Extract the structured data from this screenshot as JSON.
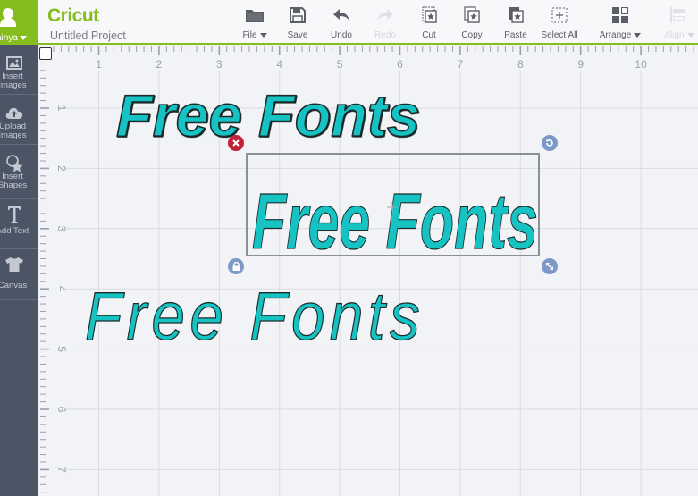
{
  "app": {
    "brand": "Cricut",
    "project_title": "Untitled Project"
  },
  "user": {
    "name": "ainya"
  },
  "toolbar": {
    "file": "File",
    "save": "Save",
    "undo": "Undo",
    "redo": "Redo",
    "cut": "Cut",
    "copy": "Copy",
    "paste": "Paste",
    "select_all": "Select All",
    "arrange": "Arrange",
    "align": "Align"
  },
  "sidebar": {
    "items": [
      {
        "label": "Insert\nImages",
        "icon": "image-icon"
      },
      {
        "label": "Upload\nImages",
        "icon": "cloud-upload-icon"
      },
      {
        "label": "Insert\nShapes",
        "icon": "shapes-icon"
      },
      {
        "label": "Add Text",
        "icon": "text-icon"
      },
      {
        "label": "Canvas",
        "icon": "tshirt-icon"
      }
    ]
  },
  "ruler": {
    "horizontal_labels": [
      "1",
      "2",
      "3",
      "4",
      "5",
      "6",
      "7",
      "8",
      "9",
      "10"
    ],
    "vertical_labels": [
      "1",
      "2",
      "3",
      "4",
      "5",
      "6",
      "7"
    ]
  },
  "canvas": {
    "text_objects": [
      {
        "text": "Free Fonts",
        "style": "brush script",
        "selected": false
      },
      {
        "text": "Free Fonts",
        "style": "handwritten",
        "selected": true
      },
      {
        "text": "Free Fonts",
        "style": "calligraphy italic",
        "selected": false
      }
    ],
    "fill_color": "#17c2c3",
    "outline_color": "#1d2b2b"
  },
  "colors": {
    "accent": "#85bd1f",
    "sidebar": "#4c5566",
    "delete_handle": "#c0223a",
    "handle": "#7b9ac7"
  }
}
